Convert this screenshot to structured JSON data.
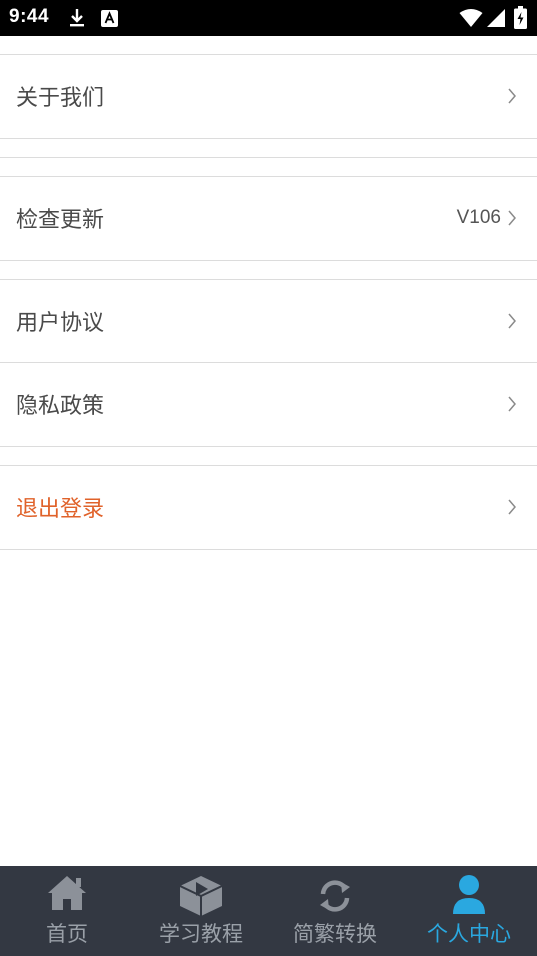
{
  "status_bar": {
    "time": "9:44",
    "icons": [
      "download-icon",
      "a-notification-icon",
      "wifi-icon",
      "signal-icon",
      "battery-icon"
    ]
  },
  "menu": {
    "about_us": "关于我们",
    "check_update": "检查更新",
    "version": "V106",
    "user_agreement": "用户协议",
    "privacy_policy": "隐私政策",
    "logout": "退出登录"
  },
  "colors": {
    "logout_text": "#e0622a",
    "tab_active": "#2aa8e0",
    "tab_inactive": "#9aa0a8",
    "tab_background": "#333842"
  },
  "tabs": [
    {
      "label": "首页",
      "icon": "home-icon",
      "active": false
    },
    {
      "label": "学习教程",
      "icon": "tutorial-box-icon",
      "active": false
    },
    {
      "label": "简繁转换",
      "icon": "convert-icon",
      "active": false
    },
    {
      "label": "个人中心",
      "icon": "person-icon",
      "active": true
    }
  ]
}
